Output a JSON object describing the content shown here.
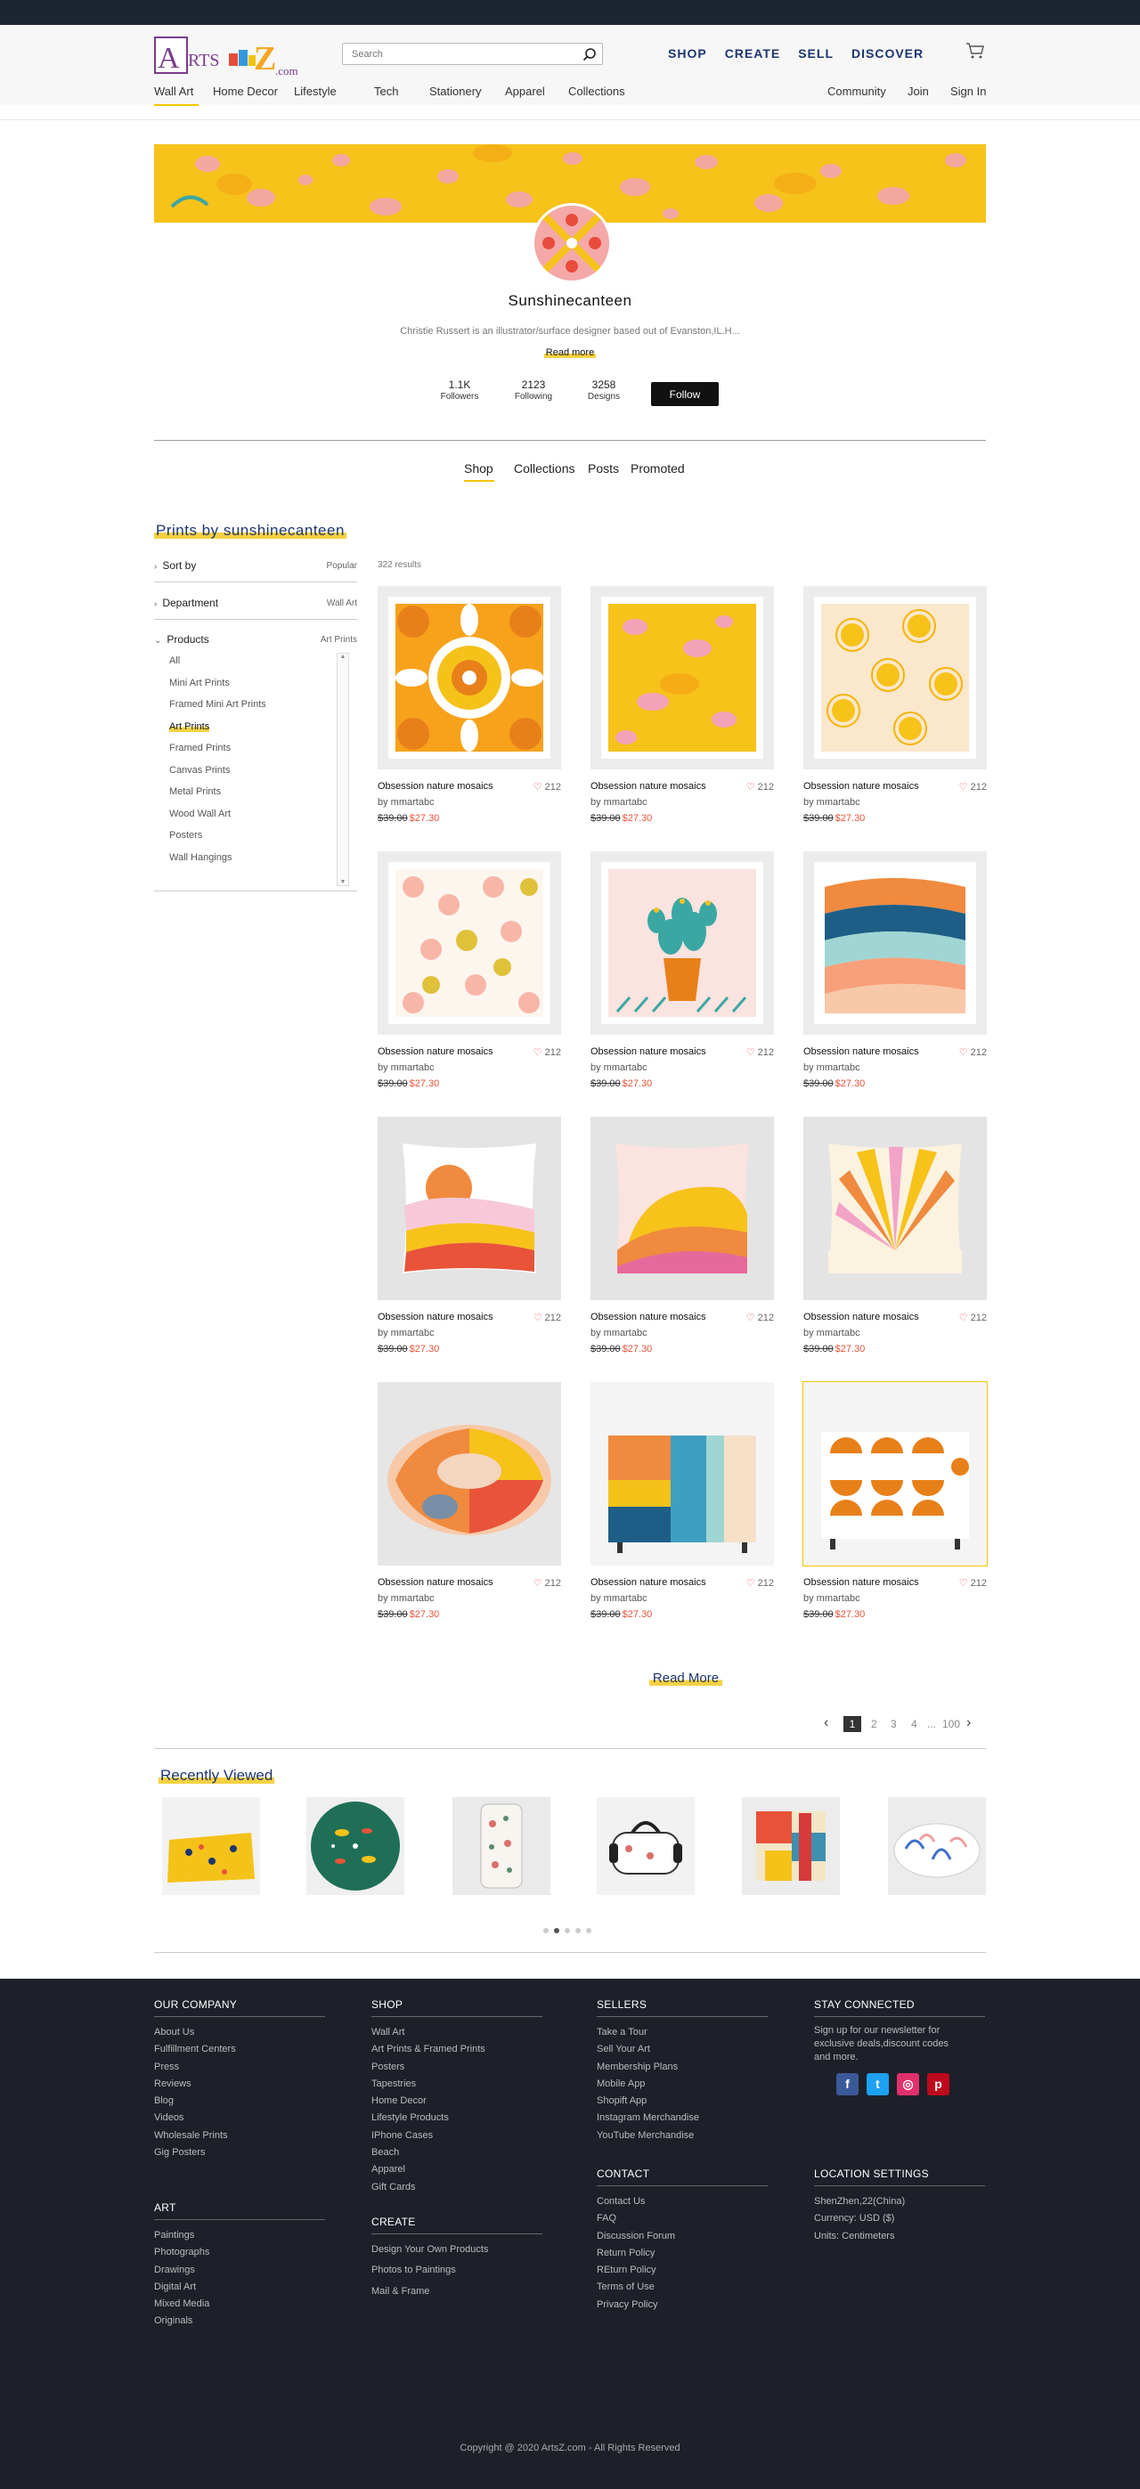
{
  "header": {
    "logo_text": "ARTS Z.com",
    "search_placeholder": "Search",
    "main_nav": [
      "SHOP",
      "CREATE",
      "SELL",
      "DISCOVER"
    ],
    "categories": [
      "Wall Art",
      "Home Decor",
      "Lifestyle",
      "Tech",
      "Stationery",
      "Apparel",
      "Collections"
    ],
    "right_links": [
      "Community",
      "Join",
      "Sign In"
    ]
  },
  "profile": {
    "username": "Sunshinecanteen",
    "bio": "Christie Russert is an illustrator/surface designer based out of Evanston,IL.H...",
    "read_more": "Read more",
    "stats": [
      {
        "value": "1.1K",
        "label": "Followers"
      },
      {
        "value": "2123",
        "label": "Following"
      },
      {
        "value": "3258",
        "label": "Designs"
      }
    ],
    "follow_label": "Follow"
  },
  "tabs": [
    "Shop",
    "Collections",
    "Posts",
    "Promoted"
  ],
  "shop": {
    "section_title": "Prints by sunshinecanteen",
    "results": "322 results",
    "filters": {
      "sort_by": {
        "label": "Sort by",
        "value": "Popular"
      },
      "department": {
        "label": "Department",
        "value": "Wall Art"
      },
      "products": {
        "label": "Products",
        "value": "Art Prints"
      }
    },
    "product_types": [
      "All",
      "Mini Art Prints",
      "Framed Mini Art Prints",
      "Art Prints",
      "Framed Prints",
      "Canvas Prints",
      "Metal Prints",
      "Wood Wall Art",
      "Posters",
      "Wall Hangings"
    ],
    "selected_product_type": "Art Prints",
    "cards": [
      {
        "title": "Obsession nature mosaics",
        "likes": "212",
        "by": "by mmartabc",
        "old_price": "$39.00",
        "new_price": "$27.30"
      },
      {
        "title": "Obsession nature mosaics",
        "likes": "212",
        "by": "by mmartabc",
        "old_price": "$39.00",
        "new_price": "$27.30"
      },
      {
        "title": "Obsession nature mosaics",
        "likes": "212",
        "by": "by mmartabc",
        "old_price": "$39.00",
        "new_price": "$27.30"
      },
      {
        "title": "Obsession nature mosaics",
        "likes": "212",
        "by": "by mmartabc",
        "old_price": "$39.00",
        "new_price": "$27.30"
      },
      {
        "title": "Obsession nature mosaics",
        "likes": "212",
        "by": "by mmartabc",
        "old_price": "$39.00",
        "new_price": "$27.30"
      },
      {
        "title": "Obsession nature mosaics",
        "likes": "212",
        "by": "by mmartabc",
        "old_price": "$39.00",
        "new_price": "$27.30"
      },
      {
        "title": "Obsession nature mosaics",
        "likes": "212",
        "by": "by mmartabc",
        "old_price": "$39.00",
        "new_price": "$27.30"
      },
      {
        "title": "Obsession nature mosaics",
        "likes": "212",
        "by": "by mmartabc",
        "old_price": "$39.00",
        "new_price": "$27.30"
      },
      {
        "title": "Obsession nature mosaics",
        "likes": "212",
        "by": "by mmartabc",
        "old_price": "$39.00",
        "new_price": "$27.30"
      },
      {
        "title": "Obsession nature mosaics",
        "likes": "212",
        "by": "by mmartabc",
        "old_price": "$39.00",
        "new_price": "$27.30"
      },
      {
        "title": "Obsession nature mosaics",
        "likes": "212",
        "by": "by mmartabc",
        "old_price": "$39.00",
        "new_price": "$27.30"
      },
      {
        "title": "Obsession nature mosaics",
        "likes": "212",
        "by": "by mmartabc",
        "old_price": "$39.00",
        "new_price": "$27.30"
      }
    ],
    "read_more": "Read More",
    "pagination": {
      "pages": [
        "1",
        "2",
        "3",
        "4"
      ],
      "ellipsis": "...",
      "last": "100",
      "current": "1"
    }
  },
  "recently_viewed": {
    "title": "Recently Viewed"
  },
  "footer": {
    "our_company": {
      "title": "OUR  COMPANY",
      "links": [
        "About Us",
        "Fulfillment Centers",
        "Press",
        "Reviews",
        "Blog",
        "Videos",
        "Wholesale Prints",
        "Gig Posters"
      ]
    },
    "art": {
      "title": "ART",
      "links": [
        "Paintings",
        "Photographs",
        "Drawings",
        "Digital Art",
        "Mixed Media",
        "Originals"
      ]
    },
    "shop": {
      "title": "SHOP",
      "links": [
        "Wall Art",
        "Art Prints & Framed Prints",
        "Posters",
        "Tapestries",
        "Home Decor",
        "Lifestyle Products",
        "IPhone Cases",
        "Beach",
        "Apparel",
        "Gift Cards"
      ]
    },
    "create": {
      "title": "CREATE",
      "links": [
        "Design Your Own Products",
        "Photos to Paintings",
        "Mail & Frame"
      ]
    },
    "sellers": {
      "title": "SELLERS",
      "links": [
        "Take a Tour",
        "Sell Your Art",
        "Membership Plans",
        "Mobile App",
        "Shopift  App",
        "Instagram Merchandise",
        "YouTube Merchandise"
      ]
    },
    "contact": {
      "title": "CONTACT",
      "links": [
        "Contact Us",
        "FAQ",
        "Discussion Forum",
        "Return Policy",
        "REturn Policy",
        "Terms of Use",
        "Privacy Policy"
      ]
    },
    "stay_connected": {
      "title": "STAY CONNECTED",
      "text": "Sign up for our newsletter for exclusive deals,discount codes and more."
    },
    "location": {
      "title": "LOCATION SETTINGS",
      "lines": [
        "ShenZhen,22(China)",
        "Currency: USD ($)",
        "Units: Centimeters"
      ]
    },
    "copyright": "Copyright @ 2020 ArtsZ.com - All Rights Reserved"
  },
  "colors": {
    "accent_yellow": "#f5c400",
    "navy": "#1d3570",
    "footer_bg": "#1d2029",
    "sale_red": "#e8533a"
  }
}
